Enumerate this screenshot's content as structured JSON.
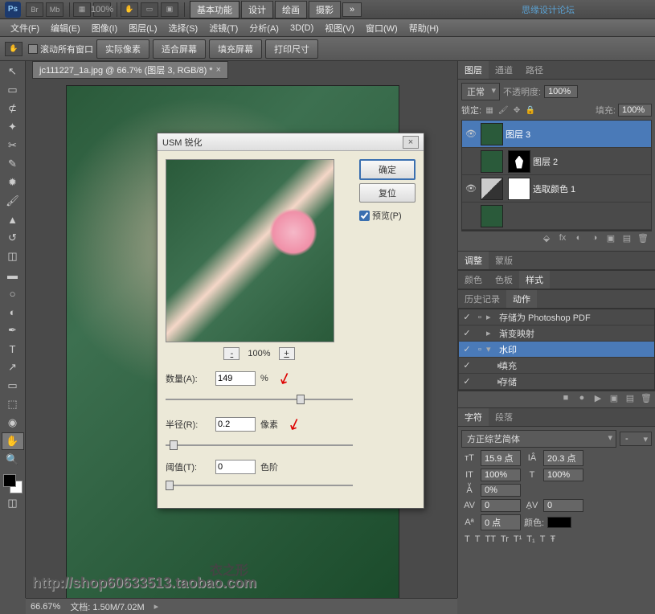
{
  "topbar": {
    "zoom": "100%",
    "workspaces": [
      "基本功能",
      "设计",
      "绘画",
      "摄影",
      "»"
    ],
    "brand": "思缘设计论坛"
  },
  "menubar": [
    "文件(F)",
    "编辑(E)",
    "图像(I)",
    "图层(L)",
    "选择(S)",
    "滤镜(T)",
    "分析(A)",
    "3D(D)",
    "视图(V)",
    "窗口(W)",
    "帮助(H)"
  ],
  "optbar": {
    "scroll_all": "滚动所有窗口",
    "buttons": [
      "实际像素",
      "适合屏幕",
      "填充屏幕",
      "打印尺寸"
    ]
  },
  "doc_tab": "jc111227_1a.jpg @ 66.7% (图层 3, RGB/8) *",
  "layers_panel": {
    "tabs": [
      "图层",
      "通道",
      "路径"
    ],
    "blend": "正常",
    "opacity_label": "不透明度:",
    "opacity": "100%",
    "lock_label": "锁定:",
    "fill_label": "填充:",
    "fill": "100%",
    "layers": [
      {
        "name": "图层 3",
        "selected": true
      },
      {
        "name": "图层 2"
      },
      {
        "name": "选取颜色 1",
        "adj": true
      }
    ]
  },
  "adjust_tabs": [
    "调整",
    "蒙版"
  ],
  "swatch_tabs": [
    "颜色",
    "色板",
    "样式"
  ],
  "history_tabs": [
    "历史记录",
    "动作"
  ],
  "actions": [
    {
      "name": "存储为 Photoshop PDF"
    },
    {
      "name": "渐变映射"
    },
    {
      "name": "水印",
      "selected": true,
      "expanded": true
    },
    {
      "name": "填充",
      "indent": true
    },
    {
      "name": "存储",
      "indent": true
    }
  ],
  "char_panel": {
    "tabs": [
      "字符",
      "段落"
    ],
    "font": "方正综艺简体",
    "style": "-",
    "size": "15.9 点",
    "leading": "20.3 点",
    "vscale": "100%",
    "hscale": "100%",
    "tracking": "0%",
    "kerning": "0",
    "baseline": "0 点",
    "color_label": "颜色:",
    "tt_buttons": [
      "T",
      "T",
      "TT",
      "Tr",
      "T¹",
      "T₁",
      "T",
      "Ŧ"
    ]
  },
  "dialog": {
    "title": "USM 锐化",
    "ok": "确定",
    "reset": "复位",
    "preview": "预览(P)",
    "zoom": "100%",
    "amount_label": "数量(A):",
    "amount": "149",
    "amount_unit": "%",
    "radius_label": "半径(R):",
    "radius": "0.2",
    "radius_unit": "像素",
    "threshold_label": "阈值(T):",
    "threshold": "0",
    "threshold_unit": "色阶"
  },
  "status": {
    "zoom": "66.67%",
    "doc": "文档: 1.50M/7.02M"
  },
  "watermark": "衣之形",
  "watermark_url": "http://shop60633513.taobao.com"
}
